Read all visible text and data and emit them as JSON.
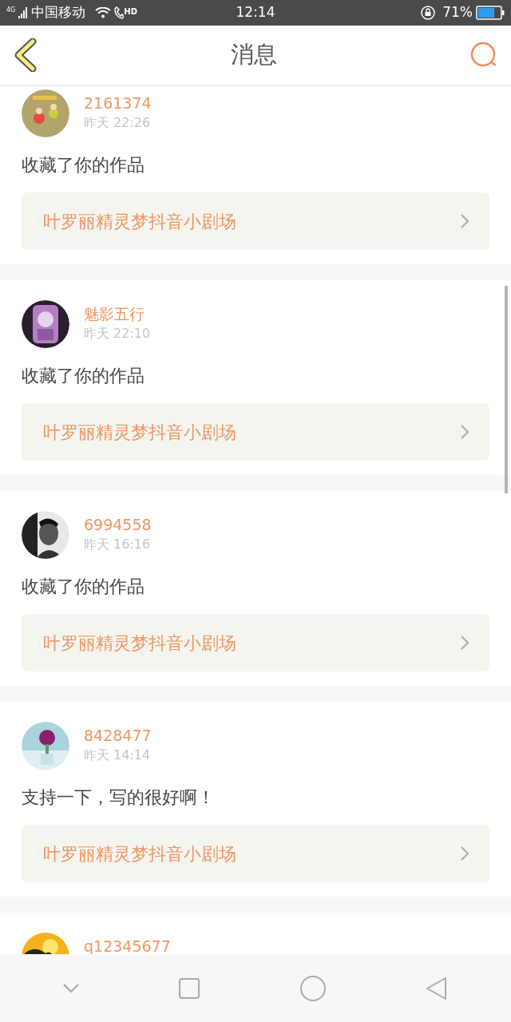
{
  "status_bar": {
    "carrier": "中国移动",
    "network": "4G",
    "call": "HD",
    "time": "12:14",
    "battery": "71%"
  },
  "header": {
    "title": "消息"
  },
  "messages": [
    {
      "user": "2161374",
      "time": "昨天 22:26",
      "text": "收藏了你的作品",
      "work": "叶罗丽精灵梦抖音小剧场"
    },
    {
      "user": "魅影五行",
      "time": "昨天 22:10",
      "text": "收藏了你的作品",
      "work": "叶罗丽精灵梦抖音小剧场"
    },
    {
      "user": "6994558",
      "time": "昨天 16:16",
      "text": "收藏了你的作品",
      "work": "叶罗丽精灵梦抖音小剧场"
    },
    {
      "user": "8428477",
      "time": "昨天 14:14",
      "text": "支持一下，写的很好啊！",
      "work": "叶罗丽精灵梦抖音小剧场"
    },
    {
      "user": "q12345677"
    }
  ]
}
